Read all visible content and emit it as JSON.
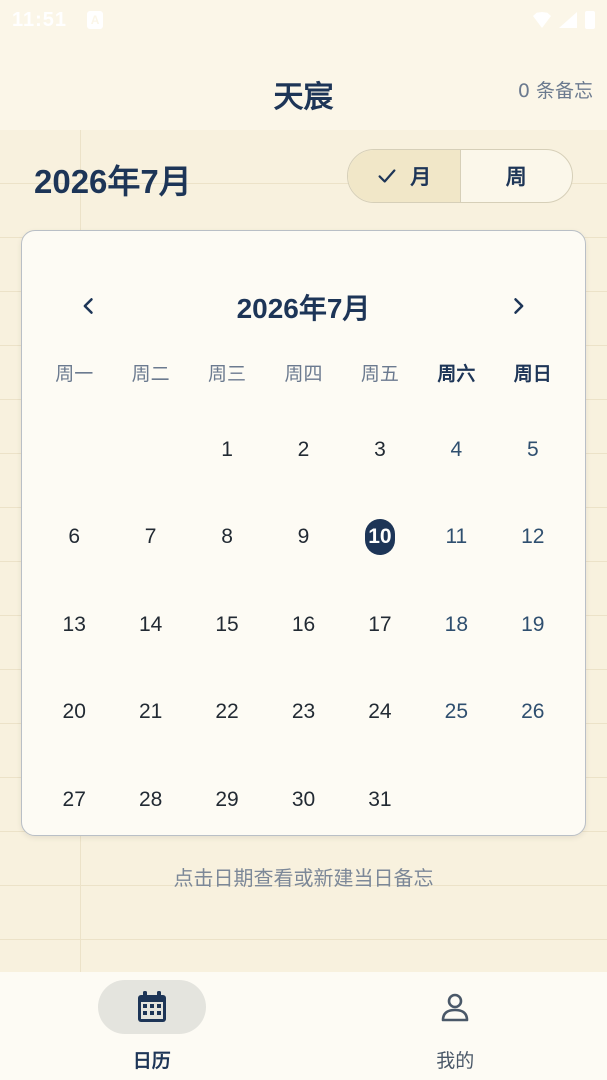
{
  "status_bar": {
    "time": "11:51",
    "badge": "A"
  },
  "app_bar": {
    "title": "天宸",
    "note_count": "0 条备忘"
  },
  "month_heading": "2026年7月",
  "view_toggle": {
    "month_label": "月",
    "week_label": "周",
    "selected": "月"
  },
  "calendar": {
    "title": "2026年7月",
    "weekdays": [
      "周一",
      "周二",
      "周三",
      "周四",
      "周五",
      "周六",
      "周日"
    ],
    "leading_blanks": 2,
    "days": [
      "1",
      "2",
      "3",
      "4",
      "5",
      "6",
      "7",
      "8",
      "9",
      "10",
      "11",
      "12",
      "13",
      "14",
      "15",
      "16",
      "17",
      "18",
      "19",
      "20",
      "21",
      "22",
      "23",
      "24",
      "25",
      "26",
      "27",
      "28",
      "29",
      "30",
      "31"
    ],
    "today": "10"
  },
  "hint": "点击日期查看或新建当日备忘",
  "bottom_nav": [
    {
      "label": "日历",
      "icon": "calendar-icon",
      "active": true
    },
    {
      "label": "我的",
      "icon": "person-icon",
      "active": false
    }
  ],
  "colors": {
    "primary": "#1d3557",
    "background": "#fbf6e8",
    "card": "#fdfbf4"
  }
}
